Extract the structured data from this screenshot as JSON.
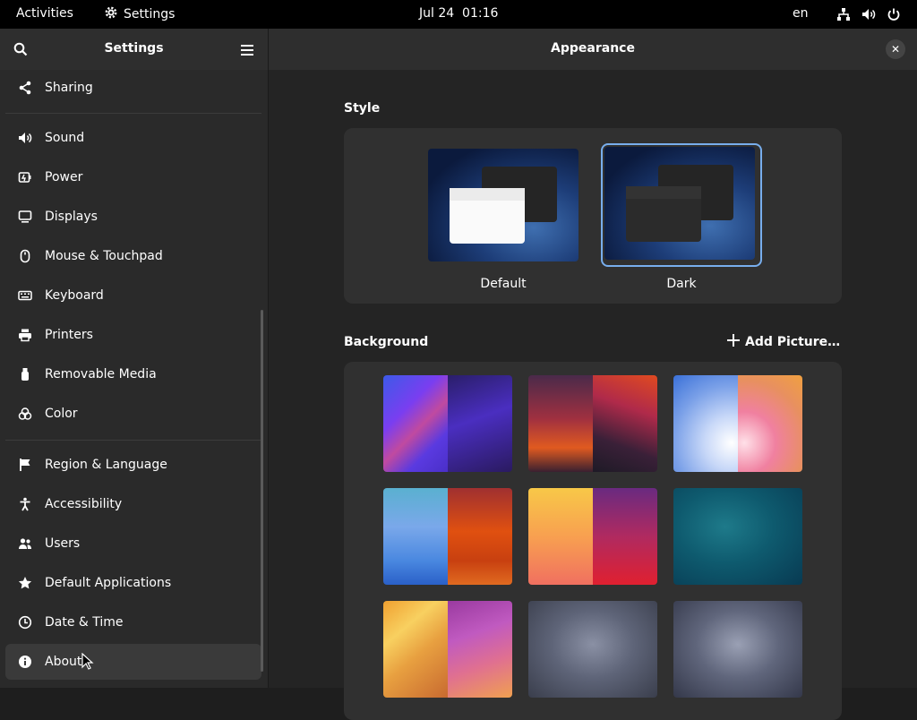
{
  "topbar": {
    "activities": "Activities",
    "app_name": "Settings",
    "clock": "Jul 24  01:16",
    "language": "en"
  },
  "sidebar": {
    "title": "Settings",
    "items": [
      {
        "label": "Sharing",
        "icon": "share-icon"
      },
      {
        "label": "Sound",
        "icon": "speaker-icon"
      },
      {
        "label": "Power",
        "icon": "battery-icon"
      },
      {
        "label": "Displays",
        "icon": "display-icon"
      },
      {
        "label": "Mouse & Touchpad",
        "icon": "mouse-icon"
      },
      {
        "label": "Keyboard",
        "icon": "keyboard-icon"
      },
      {
        "label": "Printers",
        "icon": "printer-icon"
      },
      {
        "label": "Removable Media",
        "icon": "usb-icon"
      },
      {
        "label": "Color",
        "icon": "color-icon"
      },
      {
        "label": "Region & Language",
        "icon": "flag-icon"
      },
      {
        "label": "Accessibility",
        "icon": "accessibility-icon"
      },
      {
        "label": "Users",
        "icon": "users-icon"
      },
      {
        "label": "Default Applications",
        "icon": "star-icon"
      },
      {
        "label": "Date & Time",
        "icon": "clock-icon"
      },
      {
        "label": "About",
        "icon": "info-icon"
      }
    ],
    "selected": "About"
  },
  "main": {
    "title": "Appearance",
    "style_section": {
      "label": "Style",
      "options": [
        "Default",
        "Dark"
      ],
      "selected": "Dark"
    },
    "background_section": {
      "label": "Background",
      "add_button": "Add Picture…"
    }
  },
  "colors": {
    "accent": "#78aeed",
    "sidebar_bg": "#2a2a2a",
    "main_bg": "#242424",
    "panel_bg": "#303030"
  }
}
